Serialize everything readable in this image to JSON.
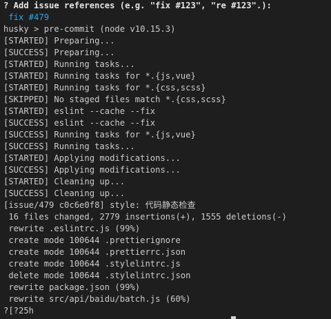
{
  "terminal": {
    "prompt_question": "? Add issue references (e.g. \"fix #123\", \"re #123\".):",
    "prompt_answer": " fix #479",
    "lines": [
      "husky > pre-commit (node v10.15.3)",
      "[STARTED] Preparing...",
      "[SUCCESS] Preparing...",
      "[STARTED] Running tasks...",
      "[STARTED] Running tasks for *.{js,vue}",
      "[STARTED] Running tasks for *.{css,scss}",
      "[SKIPPED] No staged files match *.{css,scss}",
      "[STARTED] eslint --cache --fix",
      "[SUCCESS] eslint --cache --fix",
      "[SUCCESS] Running tasks for *.{js,vue}",
      "[SUCCESS] Running tasks...",
      "[STARTED] Applying modifications...",
      "[SUCCESS] Applying modifications...",
      "[STARTED] Cleaning up...",
      "[SUCCESS] Cleaning up...",
      "[issue/479 c0c6e0f8] style: 代码静态检查",
      " 16 files changed, 2779 insertions(+), 1555 deletions(-)",
      " rewrite .eslintrc.js (99%)",
      " create mode 100644 .prettierignore",
      " create mode 100644 .prettierrc.json",
      " create mode 100644 .stylelintrc.js",
      " delete mode 100644 .stylelintrc.json",
      " rewrite package.json (99%)",
      " rewrite src/api/baidu/batch.js (60%)",
      "?[?25h"
    ]
  },
  "colors": {
    "background": "#1e1e1e",
    "text": "#cccccc",
    "accent": "#2aa9e8"
  }
}
